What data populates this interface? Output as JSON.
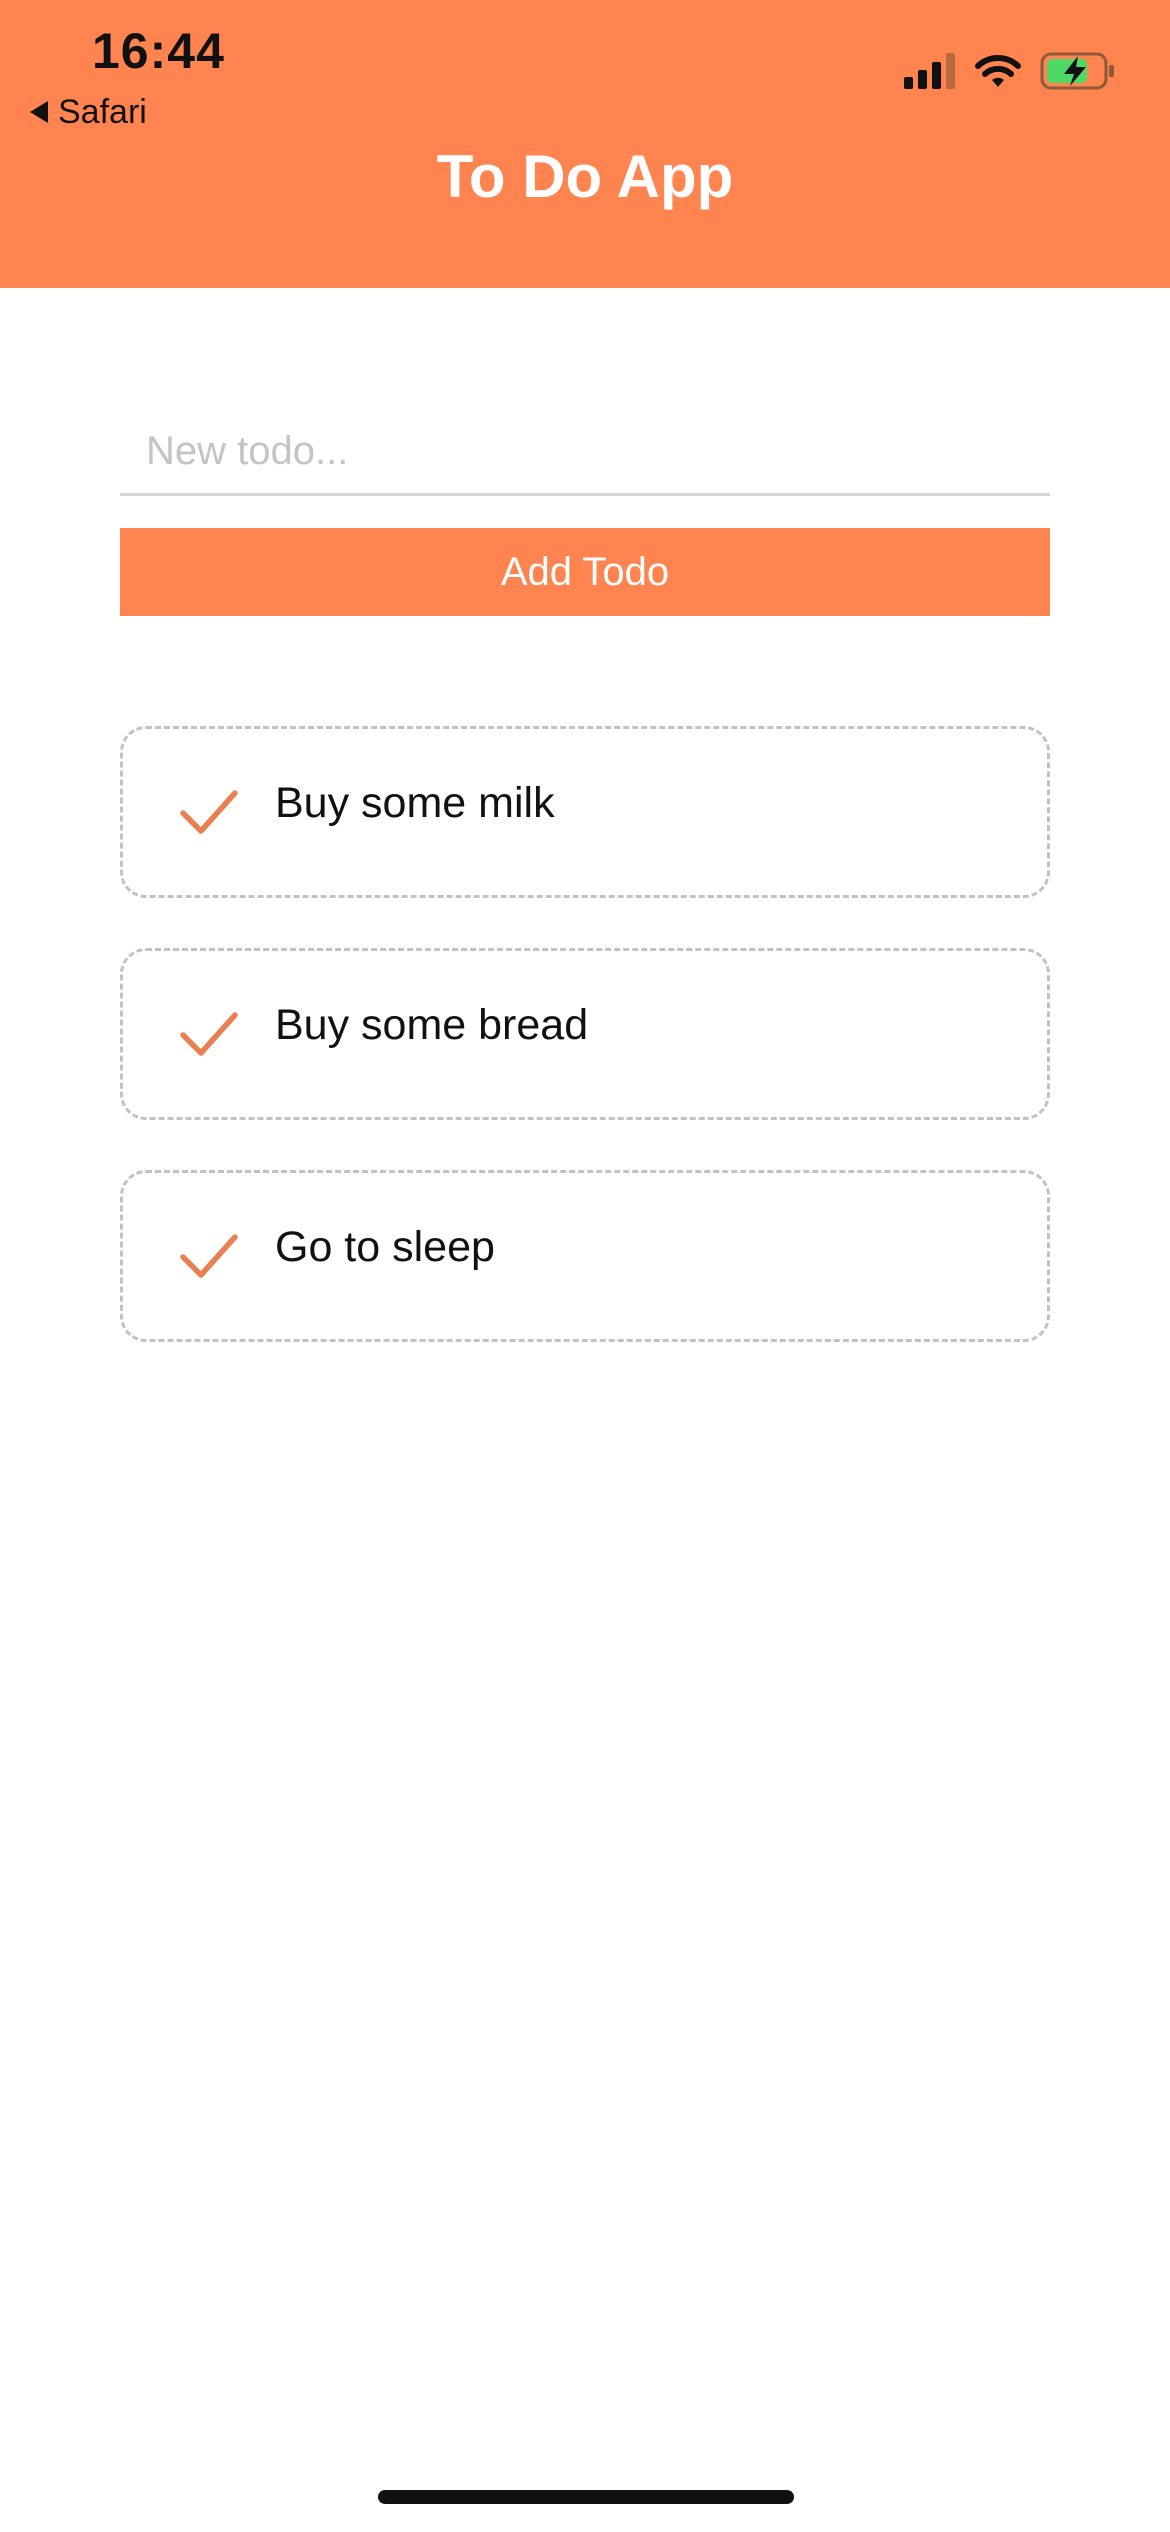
{
  "status_bar": {
    "time": "16:44",
    "back_label": "Safari",
    "icons": [
      "cellular-signal-icon",
      "wifi-icon",
      "battery-charging-icon"
    ]
  },
  "header": {
    "title": "To Do App"
  },
  "form": {
    "input_placeholder": "New todo...",
    "input_value": "",
    "add_button_label": "Add Todo"
  },
  "todos": [
    {
      "text": "Buy some milk"
    },
    {
      "text": "Buy some bread"
    },
    {
      "text": "Go to sleep"
    }
  ],
  "colors": {
    "accent": "#FF8450",
    "check": "#E98051",
    "battery_fill": "#4CD964",
    "border_dashed": "#C2C2C2"
  }
}
